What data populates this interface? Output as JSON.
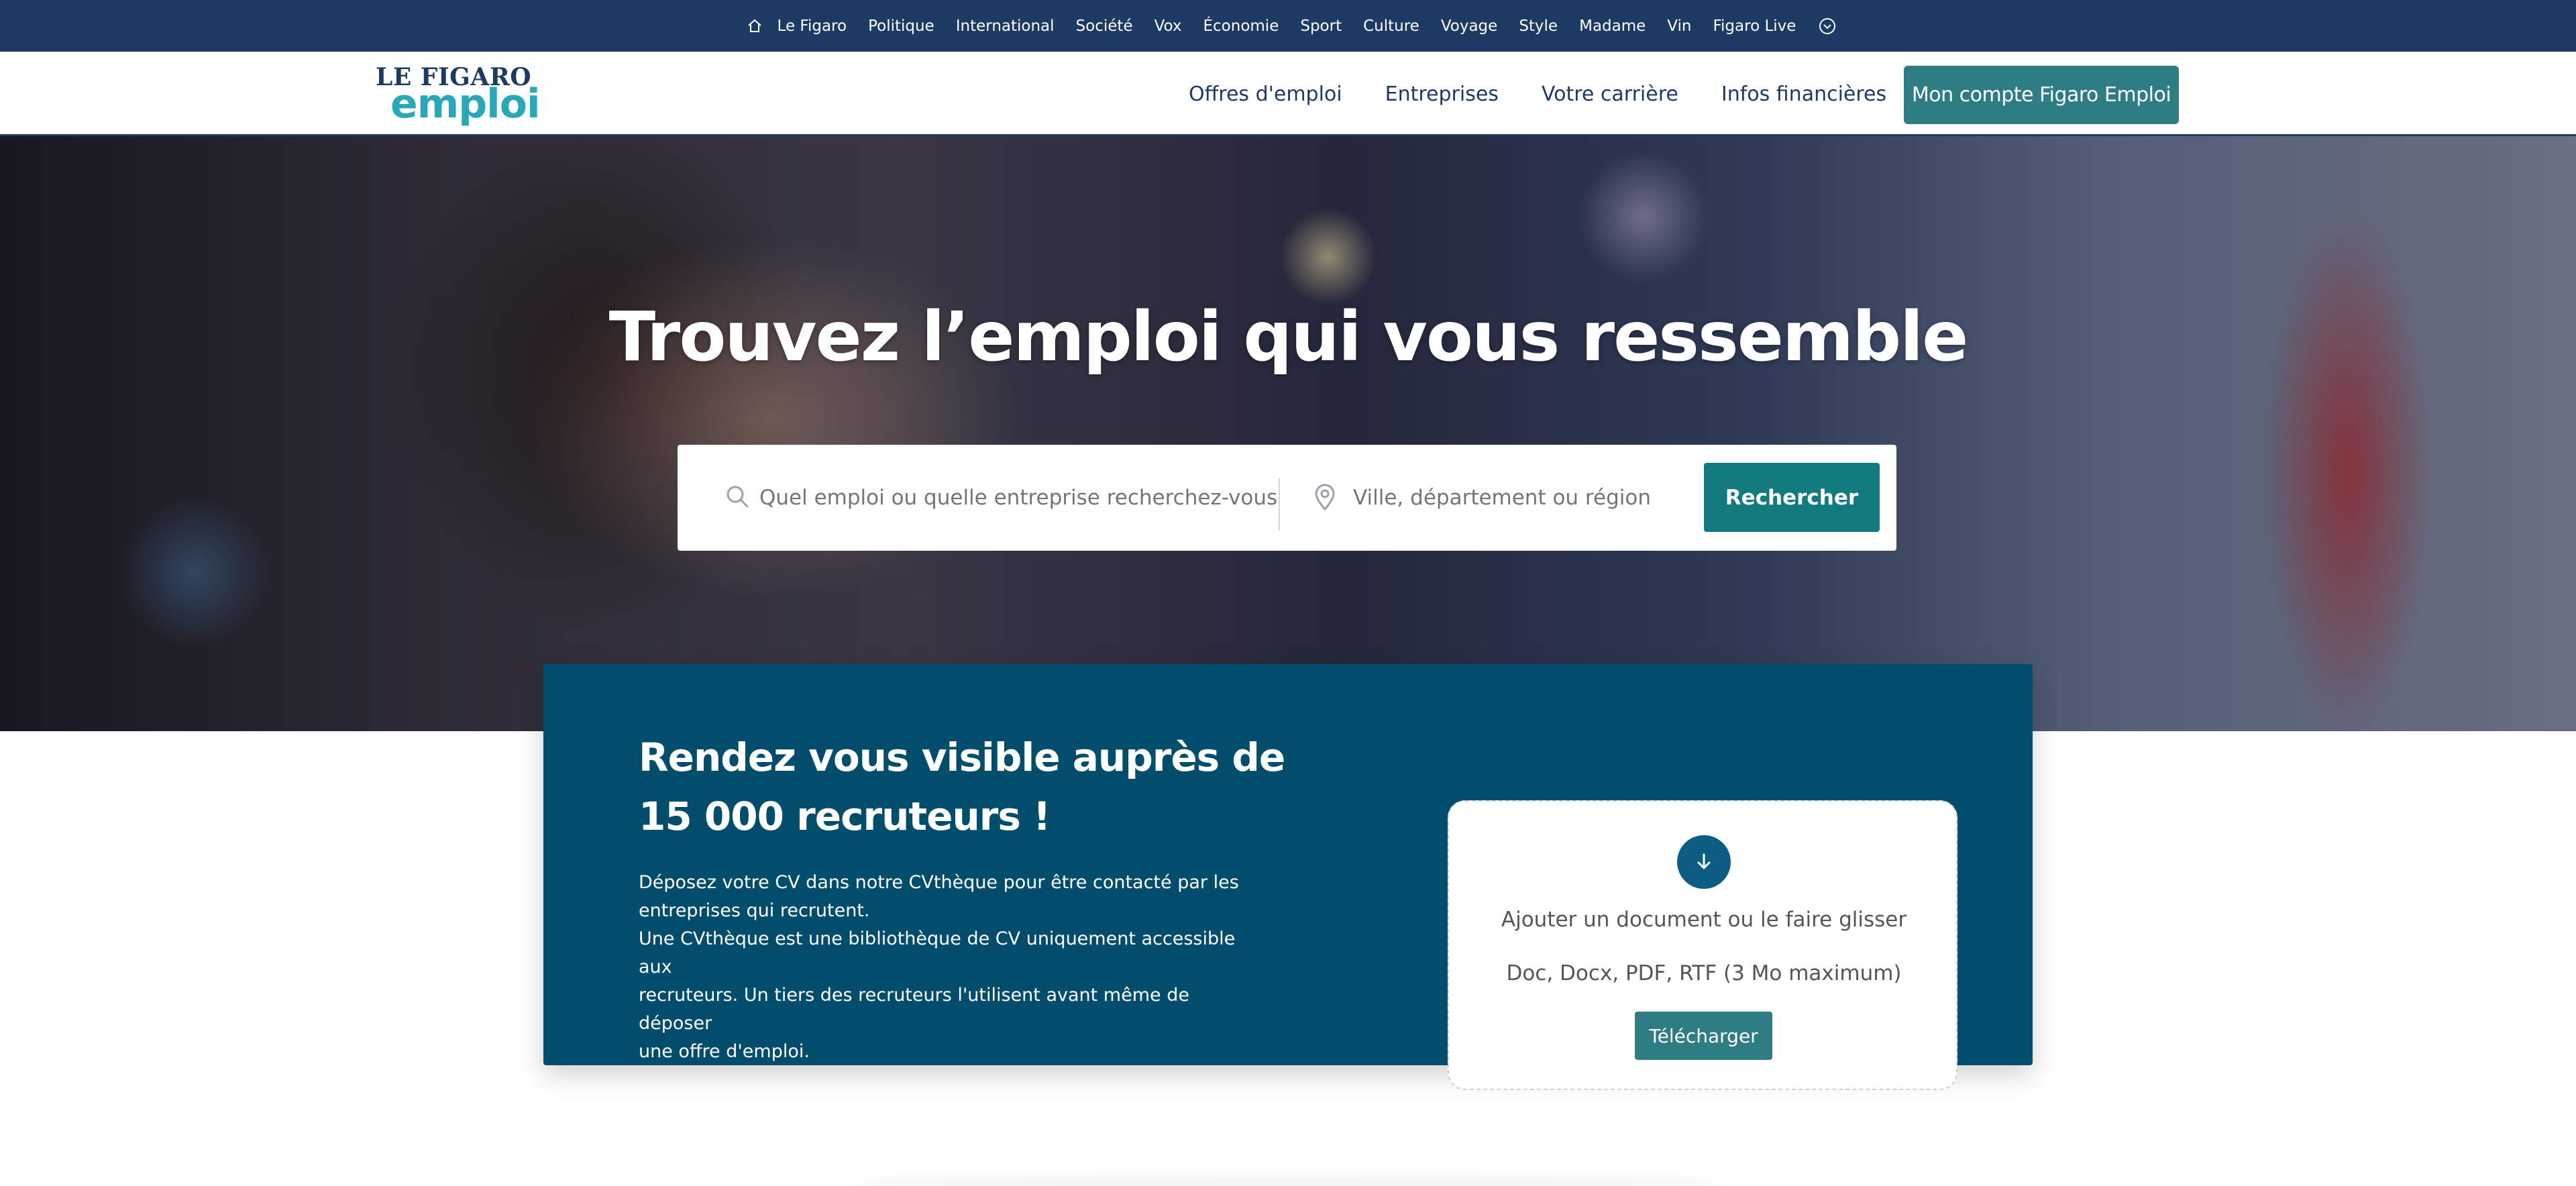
{
  "topbar": {
    "items": [
      "Le Figaro",
      "Politique",
      "International",
      "Société",
      "Vox",
      "Économie",
      "Sport",
      "Culture",
      "Voyage",
      "Style",
      "Madame",
      "Vin",
      "Figaro Live"
    ],
    "icons": {
      "home": "home-icon",
      "more": "chevron-down-circle-icon"
    }
  },
  "header": {
    "logo_top": "LE FIGARO",
    "logo_bottom": "emploi",
    "nav": [
      "Offres d'emploi",
      "Entreprises",
      "Votre carrière",
      "Infos financières"
    ],
    "account_button": "Mon compte Figaro Emploi"
  },
  "hero": {
    "title": "Trouvez l’emploi qui vous ressemble",
    "search_placeholder": "Quel emploi ou quelle entreprise recherchez-vous ?",
    "location_placeholder": "Ville, département ou région",
    "search_button": "Rechercher"
  },
  "cv": {
    "title_line1": "Rendez vous visible auprès de",
    "title_line2": "15 000 recruteurs !",
    "text_line1": "Déposez votre CV dans notre CVthèque pour être contacté par les",
    "text_line2": "entreprises qui recrutent.",
    "text_line3": "Une CVthèque est une bibliothèque de CV uniquement accessible aux",
    "text_line4": "recruteurs. Un tiers des recruteurs l'utilisent avant même de déposer",
    "text_line5": "une offre d'emploi.",
    "upload_label": "Ajouter un document ou le faire glisser",
    "upload_formats": "Doc, Docx, PDF, RTF (3 Mo maximum)",
    "upload_button": "Télécharger"
  },
  "colors": {
    "topbar": "#1d3a63",
    "accent": "#2e7d84",
    "search_button": "#127b80",
    "cv_card": "#024d6b",
    "logo_emploi": "#2ba8b8"
  }
}
